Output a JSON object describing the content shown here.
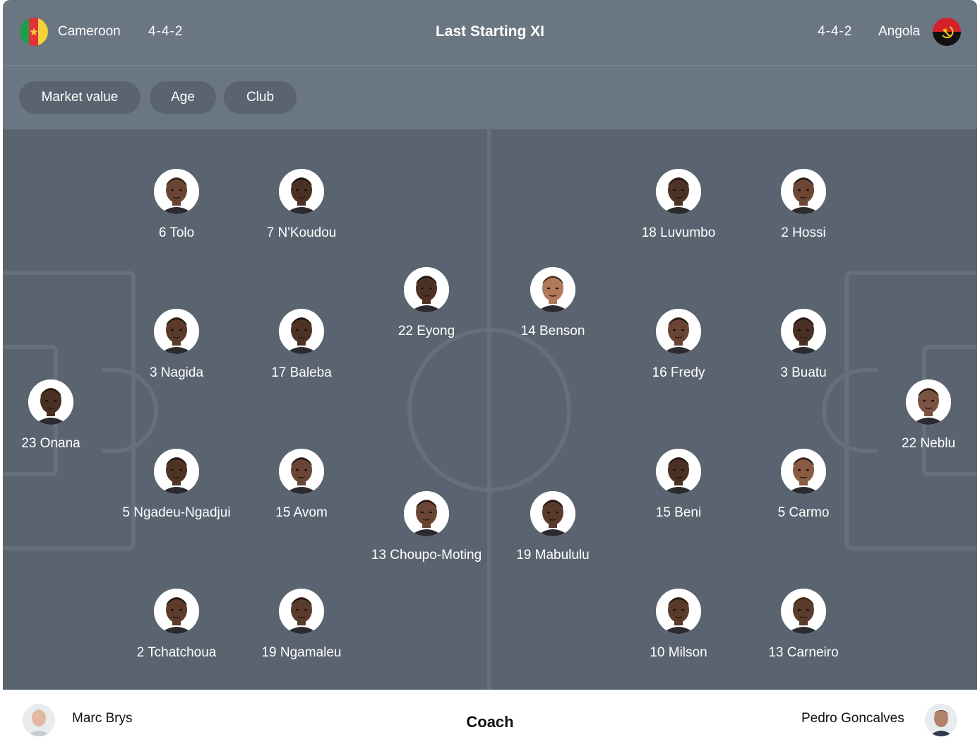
{
  "header": {
    "title": "Last Starting XI",
    "home": {
      "name": "Cameroon",
      "formation": "4-4-2",
      "flag_icon": "cameroon-flag-icon"
    },
    "away": {
      "name": "Angola",
      "formation": "4-4-2",
      "flag_icon": "angola-flag-icon"
    }
  },
  "filters": [
    "Market value",
    "Age",
    "Club"
  ],
  "colors": {
    "header_bg": "#6b7683",
    "pitch_bg": "#5a6470",
    "pitch_lines": "#65707c",
    "text": "#ffffff"
  },
  "home_players": [
    {
      "label": "23 Onana",
      "skin": "#4a2f22",
      "hair": "#1a1410"
    },
    {
      "label": "3 Nagida",
      "skin": "#5a3a2a",
      "hair": "#1e1712"
    },
    {
      "label": "5 Ngadeu-Ngadjui",
      "skin": "#4f3426",
      "hair": "#1a1410"
    },
    {
      "label": "6 Tolo",
      "skin": "#6a4433",
      "hair": "#2a1d15"
    },
    {
      "label": "2 Tchatchoua",
      "skin": "#5c3b2b",
      "hair": "#1a1410"
    },
    {
      "label": "17 Baleba",
      "skin": "#4e3325",
      "hair": "#1a1410"
    },
    {
      "label": "15 Avom",
      "skin": "#6a4535",
      "hair": "#1a1410"
    },
    {
      "label": "7 N'Koudou",
      "skin": "#4b3124",
      "hair": "#151010"
    },
    {
      "label": "19 Ngamaleu",
      "skin": "#5a3b2c",
      "hair": "#1a1410"
    },
    {
      "label": "22 Eyong",
      "skin": "#4d3224",
      "hair": "#1a1410"
    },
    {
      "label": "13 Choupo-Moting",
      "skin": "#6b4534",
      "hair": "#1a1410"
    }
  ],
  "away_players": [
    {
      "label": "22 Neblu",
      "skin": "#7a5340",
      "hair": "#1a1410"
    },
    {
      "label": "2 Hossi",
      "skin": "#6e4634",
      "hair": "#1a1410"
    },
    {
      "label": "3 Buatu",
      "skin": "#4a3023",
      "hair": "#1a1410"
    },
    {
      "label": "5 Carmo",
      "skin": "#8a5a42",
      "hair": "#1a1410"
    },
    {
      "label": "13 Carneiro",
      "skin": "#5b3b2b",
      "hair": "#3a2618"
    },
    {
      "label": "18 Luvumbo",
      "skin": "#4e3225",
      "hair": "#1a1410"
    },
    {
      "label": "16 Fredy",
      "skin": "#6a4433",
      "hair": "#1a1410"
    },
    {
      "label": "15 Beni",
      "skin": "#4b3124",
      "hair": "#1a1410"
    },
    {
      "label": "10 Milson",
      "skin": "#5a3a2a",
      "hair": "#1a1410"
    },
    {
      "label": "14 Benson",
      "skin": "#b07a5a",
      "hair": "#3a2a1e"
    },
    {
      "label": "19 Mabululu",
      "skin": "#5a3a2a",
      "hair": "#1a1410"
    }
  ],
  "coach": {
    "label": "Coach",
    "home_name": "Marc Brys",
    "away_name": "Pedro Goncalves"
  }
}
